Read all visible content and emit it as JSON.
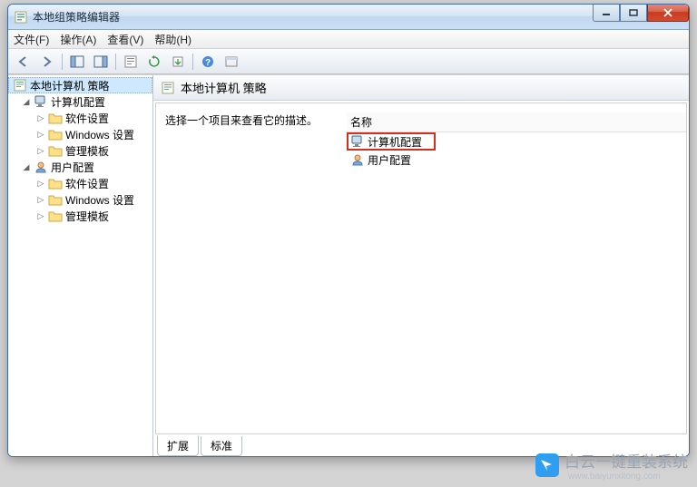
{
  "window": {
    "title": "本地组策略编辑器"
  },
  "menu": {
    "file": "文件(F)",
    "action": "操作(A)",
    "view": "查看(V)",
    "help": "帮助(H)"
  },
  "tree": {
    "root": "本地计算机 策略",
    "computer_config": "计算机配置",
    "software_settings": "软件设置",
    "windows_settings": "Windows 设置",
    "admin_templates": "管理模板",
    "user_config": "用户配置"
  },
  "right": {
    "header": "本地计算机 策略",
    "desc_prompt": "选择一个项目来查看它的描述。",
    "col_name": "名称",
    "items": {
      "computer_config": "计算机配置",
      "user_config": "用户配置"
    }
  },
  "tabs": {
    "extended": "扩展",
    "standard": "标准"
  },
  "watermark": {
    "main": "白云一键重装系统",
    "sub": "www.baiyunxitong.com"
  }
}
